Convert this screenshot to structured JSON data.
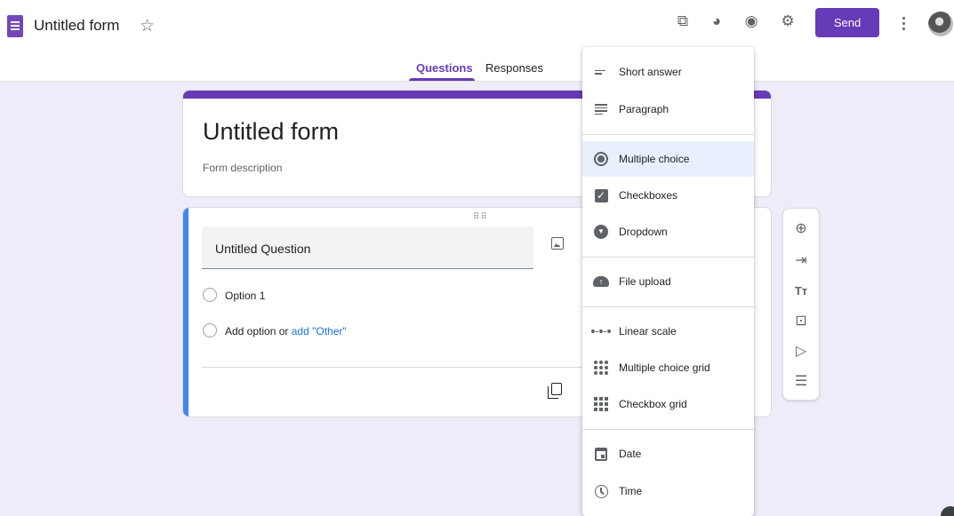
{
  "header": {
    "form_title": "Untitled form",
    "send_label": "Send",
    "tabs": [
      {
        "label": "Questions",
        "active": true
      },
      {
        "label": "Responses",
        "active": false
      }
    ],
    "icons": [
      "addons-icon",
      "palette-icon",
      "preview-eye-icon",
      "settings-icon",
      "more-vert-icon"
    ]
  },
  "form": {
    "title": "Untitled form",
    "description_placeholder": "Form description"
  },
  "question": {
    "title": "Untitled Question",
    "options": [
      "Option 1"
    ],
    "add_option": "Add option",
    "or_text": "or",
    "add_other": "add \"Other\""
  },
  "type_menu": {
    "items": [
      {
        "label": "Short answer",
        "icon": "short-answer-icon"
      },
      {
        "label": "Paragraph",
        "icon": "paragraph-icon"
      },
      {
        "label": "Multiple choice",
        "icon": "radio-icon",
        "selected": true
      },
      {
        "label": "Checkboxes",
        "icon": "checkbox-icon"
      },
      {
        "label": "Dropdown",
        "icon": "dropdown-icon"
      },
      {
        "label": "File upload",
        "icon": "cloud-upload-icon"
      },
      {
        "label": "Linear scale",
        "icon": "linear-scale-icon"
      },
      {
        "label": "Multiple choice grid",
        "icon": "radio-grid-icon"
      },
      {
        "label": "Checkbox grid",
        "icon": "checkbox-grid-icon"
      },
      {
        "label": "Date",
        "icon": "calendar-icon"
      },
      {
        "label": "Time",
        "icon": "clock-icon"
      }
    ]
  },
  "side_toolbar": [
    "add-question-icon",
    "import-questions-icon",
    "add-title-icon",
    "add-image-icon",
    "add-video-icon",
    "add-section-icon"
  ],
  "colors": {
    "accent": "#673ab7",
    "background": "#f0ebf8",
    "active_question_border": "#4285f4",
    "link": "#1a73e8",
    "menu_selected": "#e8f0fe"
  }
}
